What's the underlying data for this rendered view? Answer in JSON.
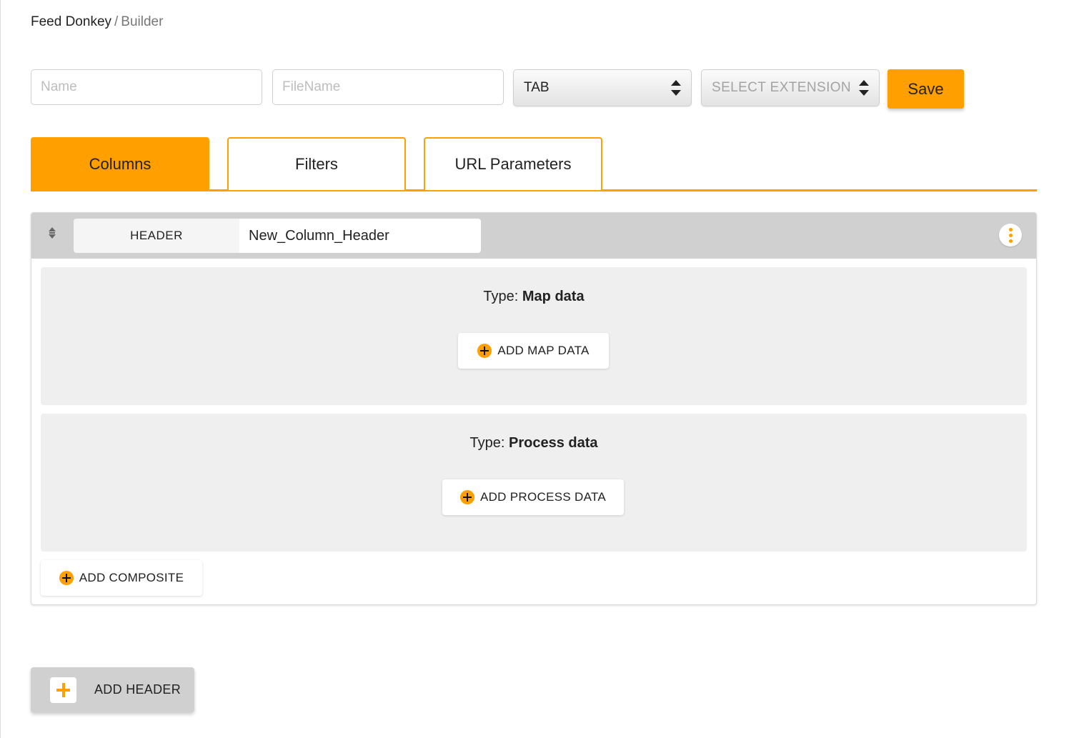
{
  "breadcrumb": {
    "root": "Feed Donkey",
    "separator": "/",
    "current": "Builder"
  },
  "toolbar": {
    "name_placeholder": "Name",
    "filename_placeholder": "FileName",
    "delimiter_value": "TAB",
    "extension_value": "SELECT EXTENSION",
    "save_label": "Save"
  },
  "tabs": [
    {
      "label": "Columns",
      "active": true
    },
    {
      "label": "Filters",
      "active": false
    },
    {
      "label": "URL Parameters",
      "active": false
    }
  ],
  "column": {
    "header_tag": "HEADER",
    "header_value": "New_Column_Header",
    "panels": [
      {
        "type_prefix": "Type:",
        "type_name": "Map data",
        "button_label": "ADD MAP DATA"
      },
      {
        "type_prefix": "Type:",
        "type_name": "Process data",
        "button_label": "ADD PROCESS DATA"
      }
    ],
    "add_composite_label": "ADD COMPOSITE"
  },
  "add_header_label": "ADD HEADER",
  "colors": {
    "accent": "#ff9f00",
    "header_bar": "#d0d0d0",
    "panel_bg": "#efefef"
  },
  "icons": [
    "drag-handle-icon",
    "kebab-menu-icon",
    "plus-circle-icon",
    "plus-icon",
    "updown-arrows-icon"
  ]
}
